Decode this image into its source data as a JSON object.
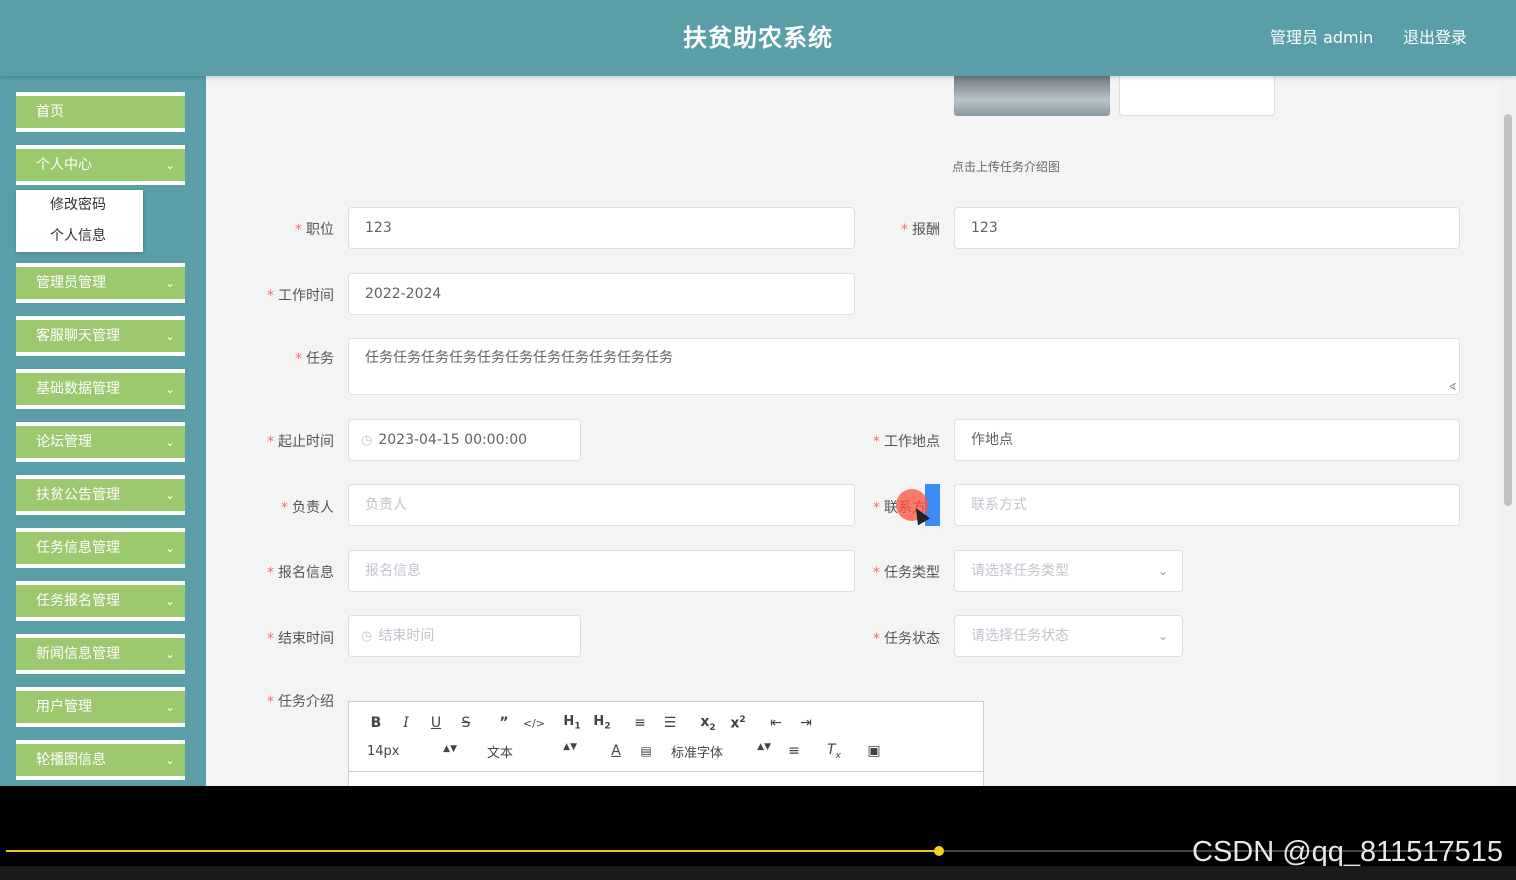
{
  "header": {
    "title": "扶贫助农系统",
    "user": "管理员 admin",
    "logout": "退出登录"
  },
  "sidebar": {
    "items": [
      {
        "label": "首页"
      },
      {
        "label": "个人中心"
      },
      {
        "label": "管理员管理"
      },
      {
        "label": "客服聊天管理"
      },
      {
        "label": "基础数据管理"
      },
      {
        "label": "论坛管理"
      },
      {
        "label": "扶贫公告管理"
      },
      {
        "label": "任务信息管理"
      },
      {
        "label": "任务报名管理"
      },
      {
        "label": "新闻信息管理"
      },
      {
        "label": "用户管理"
      },
      {
        "label": "轮播图信息"
      }
    ],
    "submenu": [
      "修改密码",
      "个人信息"
    ]
  },
  "form": {
    "upload_tip": "点击上传任务介绍图",
    "position": {
      "label": "职位",
      "value": "123"
    },
    "salary": {
      "label": "报酬",
      "value": "123"
    },
    "work_time": {
      "label": "工作时间",
      "value": "2022-2024"
    },
    "task": {
      "label": "任务",
      "value": "任务任务任务任务任务任务任务任务任务任务任务"
    },
    "start_time": {
      "label": "起止时间",
      "value": "2023-04-15 00:00:00"
    },
    "location": {
      "label": "工作地点",
      "value": "作地点"
    },
    "owner": {
      "label": "负责人",
      "placeholder": "负责人"
    },
    "contact": {
      "label": "联系方式",
      "placeholder": "联系方式"
    },
    "signup": {
      "label": "报名信息",
      "placeholder": "报名信息"
    },
    "task_type": {
      "label": "任务类型",
      "placeholder": "请选择任务类型"
    },
    "end_time": {
      "label": "结束时间",
      "placeholder": "结束时间"
    },
    "task_status": {
      "label": "任务状态",
      "placeholder": "请选择任务状态"
    },
    "intro": {
      "label": "任务介绍"
    }
  },
  "editor": {
    "font_size": "14px",
    "text_style": "文本",
    "font_family": "标准字体"
  },
  "watermark": "CSDN @qq_811517515",
  "colors": {
    "header": "#5a9ea8",
    "menu": "#9cc86e",
    "required": "#f56c6c",
    "progress": "#e8c81a"
  }
}
